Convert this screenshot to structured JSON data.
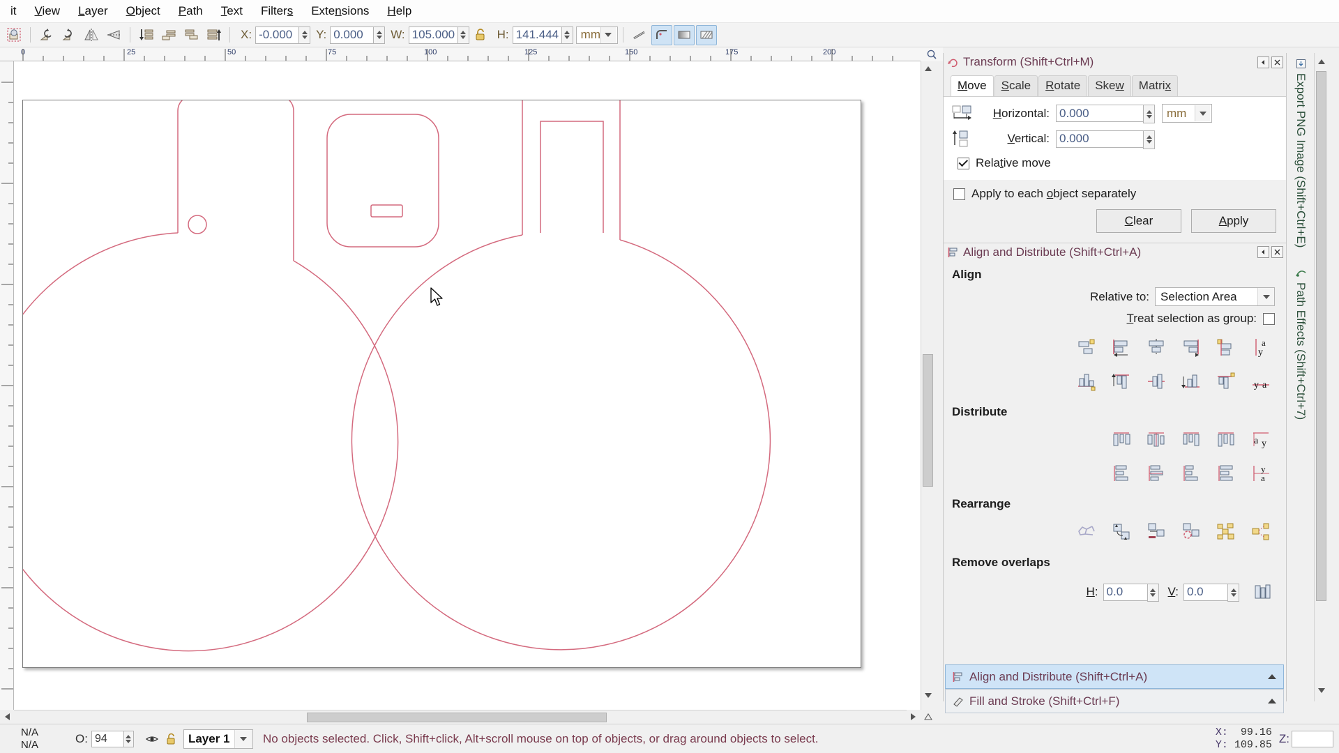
{
  "menu": {
    "items": [
      {
        "label": "it",
        "accel": ""
      },
      {
        "label": "View",
        "accel": "V"
      },
      {
        "label": "Layer",
        "accel": "L"
      },
      {
        "label": "Object",
        "accel": "O"
      },
      {
        "label": "Path",
        "accel": "P"
      },
      {
        "label": "Text",
        "accel": "T"
      },
      {
        "label": "Filters",
        "accel": "s"
      },
      {
        "label": "Extensions",
        "accel": "n"
      },
      {
        "label": "Help",
        "accel": "H"
      }
    ]
  },
  "toolbar": {
    "select_all_icon": "select-all-in-all-layers-icon",
    "rotate_ccw_icon": "rotate-90-ccw-icon",
    "rotate_cw_icon": "rotate-90-cw-icon",
    "flip_h_icon": "flip-horizontal-icon",
    "flip_v_icon": "flip-vertical-icon",
    "lower_to_bottom_icon": "lower-to-bottom-icon",
    "lower_icon": "lower-one-step-icon",
    "raise_icon": "raise-one-step-icon",
    "raise_to_top_icon": "raise-to-top-icon",
    "x_label": "X:",
    "x_value": "-0.000",
    "y_label": "Y:",
    "y_value": "0.000",
    "w_label": "W:",
    "w_value": "105.000",
    "lock_icon": "lock-wh-ratio-icon",
    "h_label": "H:",
    "h_value": "141.444",
    "units": "mm",
    "affect_stroke_icon": "affect-stroke-width-icon",
    "affect_corners_icon": "affect-rounded-corners-icon",
    "affect_gradients_icon": "affect-gradients-icon",
    "affect_patterns_icon": "affect-patterns-icon"
  },
  "canvas": {
    "ruler_h_labels": [
      "0",
      "25",
      "50",
      "75",
      "100",
      "125",
      "150",
      "175",
      "200"
    ],
    "zoom_icon": "zoom-page-icon",
    "stroke_color": "#d46a7e",
    "page_bg": "#ffffff"
  },
  "transform_panel": {
    "title": "Transform (Shift+Ctrl+M)",
    "title_icon": "transform-icon",
    "dock_icon": "dock-float-icon",
    "close_icon": "close-icon",
    "tabs": [
      "Move",
      "Scale",
      "Rotate",
      "Skew",
      "Matrix"
    ],
    "active_tab": "Move",
    "horizontal_label": "Horizontal:",
    "horizontal_value": "0.000",
    "horizontal_icon": "move-horizontal-icon",
    "vertical_label": "Vertical:",
    "vertical_value": "0.000",
    "vertical_icon": "move-vertical-icon",
    "units": "mm",
    "relative_move_label": "Relative move",
    "relative_move_checked": true,
    "apply_each_label": "Apply to each object separately",
    "apply_each_checked": false,
    "clear_label": "Clear",
    "apply_label": "Apply"
  },
  "align_panel": {
    "title": "Align and Distribute (Shift+Ctrl+A)",
    "title_icon": "align-icon",
    "dock_icon": "dock-float-icon",
    "close_icon": "close-icon",
    "align_heading": "Align",
    "relative_to_label": "Relative to:",
    "relative_to_value": "Selection Area",
    "treat_as_group_label": "Treat selection as group:",
    "treat_as_group_checked": false,
    "align_row1": [
      "align-right-edges-to-left-anchor-icon",
      "align-left-edges-icon",
      "center-on-vertical-axis-icon",
      "align-right-edges-icon",
      "align-left-edges-to-right-anchor-icon",
      "text-anchor-baseline-vertical-icon"
    ],
    "align_row2": [
      "align-bottom-to-top-anchor-icon",
      "align-top-edges-icon",
      "center-on-horizontal-axis-icon",
      "align-bottom-edges-icon",
      "align-top-to-bottom-anchor-icon",
      "text-baseline-horizontal-icon"
    ],
    "distribute_heading": "Distribute",
    "distribute_row1": [
      "distribute-left-edges-equidistantly-icon",
      "distribute-centers-horizontally-icon",
      "distribute-right-edges-equidistantly-icon",
      "distribute-horizontal-gaps-icon",
      "distribute-text-anchors-horizontally-icon"
    ],
    "distribute_row2": [
      "distribute-top-edges-equidistantly-icon",
      "distribute-centers-vertically-icon",
      "distribute-bottom-edges-equidistantly-icon",
      "distribute-vertical-gaps-icon",
      "distribute-text-baselines-vertically-icon"
    ],
    "rearrange_heading": "Rearrange",
    "rearrange_icons": [
      "graph-layout-nodes-icon",
      "exchange-positions-selection-order-icon",
      "exchange-positions-zorder-icon",
      "exchange-positions-clockwise-icon",
      "randomize-positions-icon",
      "unclump-objects-icon"
    ],
    "remove_overlaps_heading": "Remove overlaps",
    "h_label": "H:",
    "h_value": "0.0",
    "v_label": "V:",
    "v_value": "0.0",
    "remove_overlaps_icon": "remove-overlaps-icon"
  },
  "dock_bars": [
    {
      "label": "Align and Distribute (Shift+Ctrl+A)",
      "icon": "align-icon",
      "selected": true,
      "caret": "caret-up-icon"
    },
    {
      "label": "Fill and Stroke (Shift+Ctrl+F)",
      "icon": "fill-stroke-icon",
      "selected": false,
      "caret": "caret-up-icon"
    }
  ],
  "vertical_tabs": [
    {
      "label": "Export PNG Image (Shift+Ctrl+E)",
      "icon": "export-png-icon"
    },
    {
      "label": "Path Effects (Shift+Ctrl+7)",
      "icon": "path-effects-icon"
    }
  ],
  "statusbar": {
    "fill_value": "N/A",
    "stroke_value": "N/A",
    "opacity_label": "O:",
    "opacity_value": "94",
    "visibility_icon": "eye-icon",
    "lock_icon": "unlock-layer-icon",
    "layer_name": "Layer 1",
    "message": "No objects selected. Click, Shift+click, Alt+scroll mouse on top of objects, or drag around objects to select.",
    "x_label": "X:",
    "x_value": "99.16",
    "y_label": "Y:",
    "y_value": "109.85",
    "z_label": "Z:",
    "z_value": ""
  }
}
